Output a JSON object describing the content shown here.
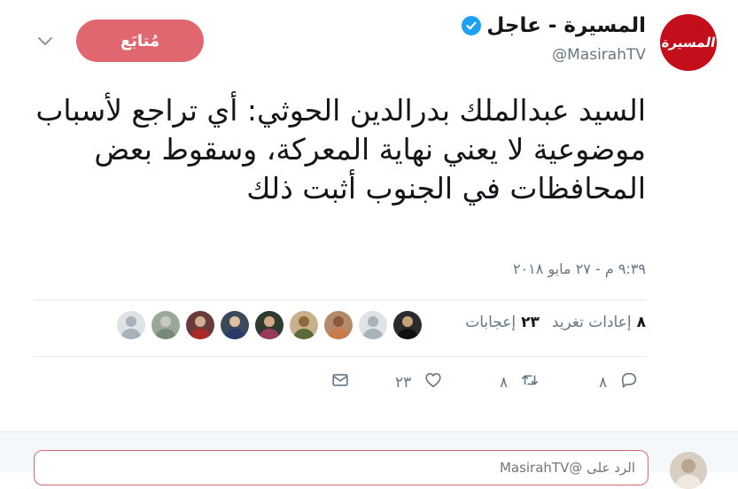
{
  "account": {
    "display_name": "المسيرة - عاجل",
    "handle": "@MasirahTV",
    "avatar_logo_text": "المسيرة",
    "verified": true
  },
  "follow_button": {
    "label": "مُتابَع"
  },
  "tweet": {
    "text": "السيد عبدالملك بدرالدين الحوثي: أي تراجع لأسباب موضوعية لا يعني نهاية المعركة، وسقوط بعض المحافظات في الجنوب أثبت ذلك",
    "timestamp": "٩:٣٩ م - ٢٧ مايو ٢٠١٨"
  },
  "stats": {
    "retweets_count": "٨",
    "retweets_label": "إعادات تغريد",
    "likes_count": "٢٣",
    "likes_label": "إعجابات"
  },
  "likers": [
    {
      "bg": "#2b2b2b",
      "head": "#c9a27c",
      "body": "#111111"
    },
    {
      "bg": "#dfe3e6",
      "head": "#a8b2bb",
      "body": "#a8b2bb"
    },
    {
      "bg": "#b48a6a",
      "head": "#8a5a3b",
      "body": "#c97b4a"
    },
    {
      "bg": "#c8b08a",
      "head": "#8a6a3a",
      "body": "#5a6a3a"
    },
    {
      "bg": "#2e3b2e",
      "head": "#d6a88a",
      "body": "#9a3a5a"
    },
    {
      "bg": "#3a4a5a",
      "head": "#e0c0a0",
      "body": "#2a3a6a"
    },
    {
      "bg": "#6a3a3a",
      "head": "#d0b090",
      "body": "#aa2a2a"
    },
    {
      "bg": "#9aa89a",
      "head": "#c8c8c0",
      "body": "#7a8a7a"
    },
    {
      "bg": "#dfe3e6",
      "head": "#a8b2bb",
      "body": "#a8b2bb"
    }
  ],
  "actions": {
    "reply_count": "٨",
    "retweet_count": "٨",
    "like_count": "٢٣"
  },
  "reply_box": {
    "placeholder": "الرد على @MasirahTV"
  },
  "colors": {
    "accent": "#e0676f",
    "brand_red": "#c40e1b",
    "verified_blue": "#1da1f2",
    "muted": "#657786"
  },
  "icons": [
    "verified-badge-icon",
    "chevron-down-icon",
    "reply-icon",
    "retweet-icon",
    "heart-icon",
    "envelope-icon"
  ]
}
